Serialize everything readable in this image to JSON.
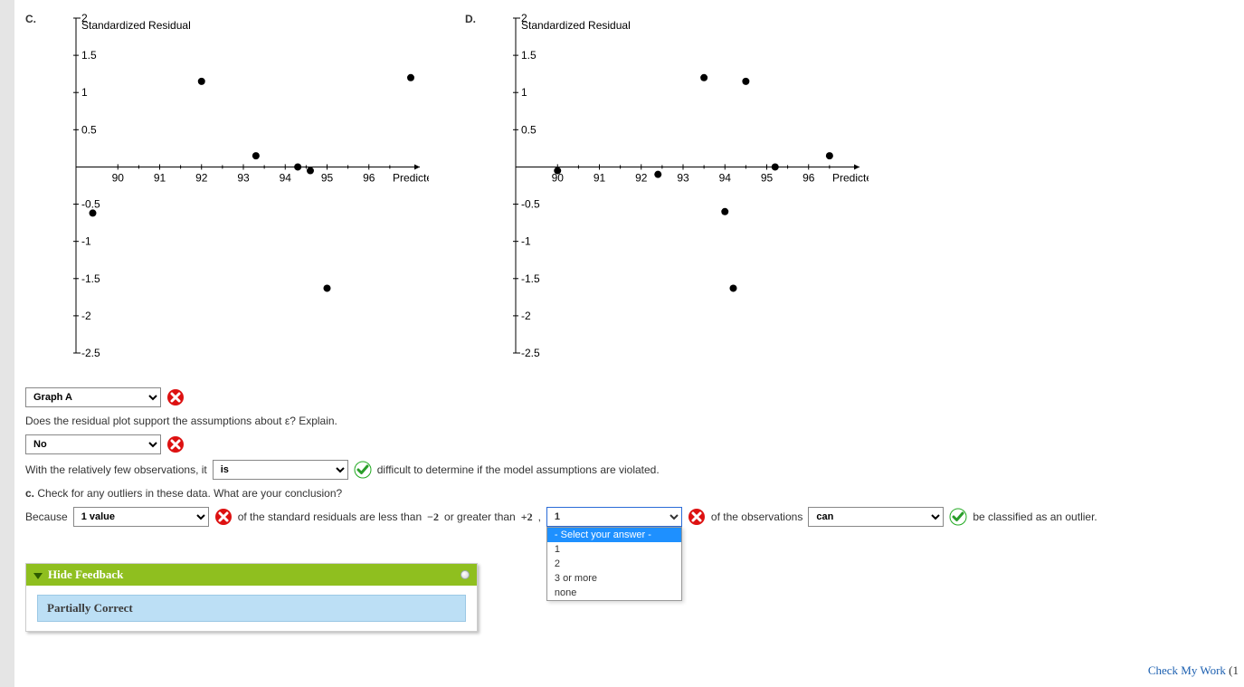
{
  "chart_data": [
    {
      "id": "C",
      "type": "scatter",
      "title": "",
      "xlabel": "Predicted y",
      "ylabel": "Standardized Residual",
      "xlim": [
        89,
        97
      ],
      "ylim": [
        -2.5,
        2.0
      ],
      "xticks": [
        90,
        91,
        92,
        93,
        94,
        95,
        96
      ],
      "yticks": [
        -2.5,
        -2,
        -1.5,
        -1,
        -0.5,
        0.5,
        1,
        1.5,
        2
      ],
      "points": [
        {
          "x": 89.4,
          "y": -0.62
        },
        {
          "x": 92.0,
          "y": 1.15
        },
        {
          "x": 93.3,
          "y": 0.15
        },
        {
          "x": 94.3,
          "y": 0.0
        },
        {
          "x": 94.6,
          "y": -0.05
        },
        {
          "x": 95.0,
          "y": -1.63
        },
        {
          "x": 97.0,
          "y": 1.2
        }
      ]
    },
    {
      "id": "D",
      "type": "scatter",
      "title": "",
      "xlabel": "Predicted y",
      "ylabel": "Standardized Residual",
      "xlim": [
        89,
        97
      ],
      "ylim": [
        -2.5,
        2.0
      ],
      "xticks": [
        90,
        91,
        92,
        93,
        94,
        95,
        96
      ],
      "yticks": [
        -2.5,
        -2,
        -1.5,
        -1,
        -0.5,
        0.5,
        1,
        1.5,
        2
      ],
      "points": [
        {
          "x": 90.0,
          "y": -0.05
        },
        {
          "x": 92.4,
          "y": -0.1
        },
        {
          "x": 93.5,
          "y": 1.2
        },
        {
          "x": 94.0,
          "y": -0.6
        },
        {
          "x": 94.2,
          "y": -1.63
        },
        {
          "x": 94.5,
          "y": 1.15
        },
        {
          "x": 95.2,
          "y": 0.0
        },
        {
          "x": 96.5,
          "y": 0.15
        }
      ]
    }
  ],
  "charts": {
    "c_letter": "C.",
    "d_letter": "D."
  },
  "select1": {
    "value": "Graph A"
  },
  "q_support": "Does the residual plot support the assumptions about ε? Explain.",
  "select2": {
    "value": "No"
  },
  "line3": {
    "pre": "With the relatively few observations, it",
    "value": "is",
    "post": "difficult to determine if the model assumptions are violated."
  },
  "partc_label": "c.",
  "partc_text": "Check for any outliers in these data. What are your conclusion?",
  "line4": {
    "pre": "Because",
    "sel_a": "1 value",
    "mid1": "of the standard residuals are less than",
    "neg2": "−2",
    "mid1b": "or greater than",
    "pos2": "+2",
    "comma": ",",
    "sel_b": "1",
    "mid2": "of the observations",
    "sel_c": "can",
    "post": "be classified as an outlier."
  },
  "dropdown_options": {
    "placeholder": "- Select your answer -",
    "o1": "1",
    "o2": "2",
    "o3": "3 or more",
    "o4": "none"
  },
  "feedback": {
    "header": "Hide Feedback",
    "status": "Partially Correct"
  },
  "footer": {
    "check": "Check My Work",
    "paren": "(1"
  }
}
